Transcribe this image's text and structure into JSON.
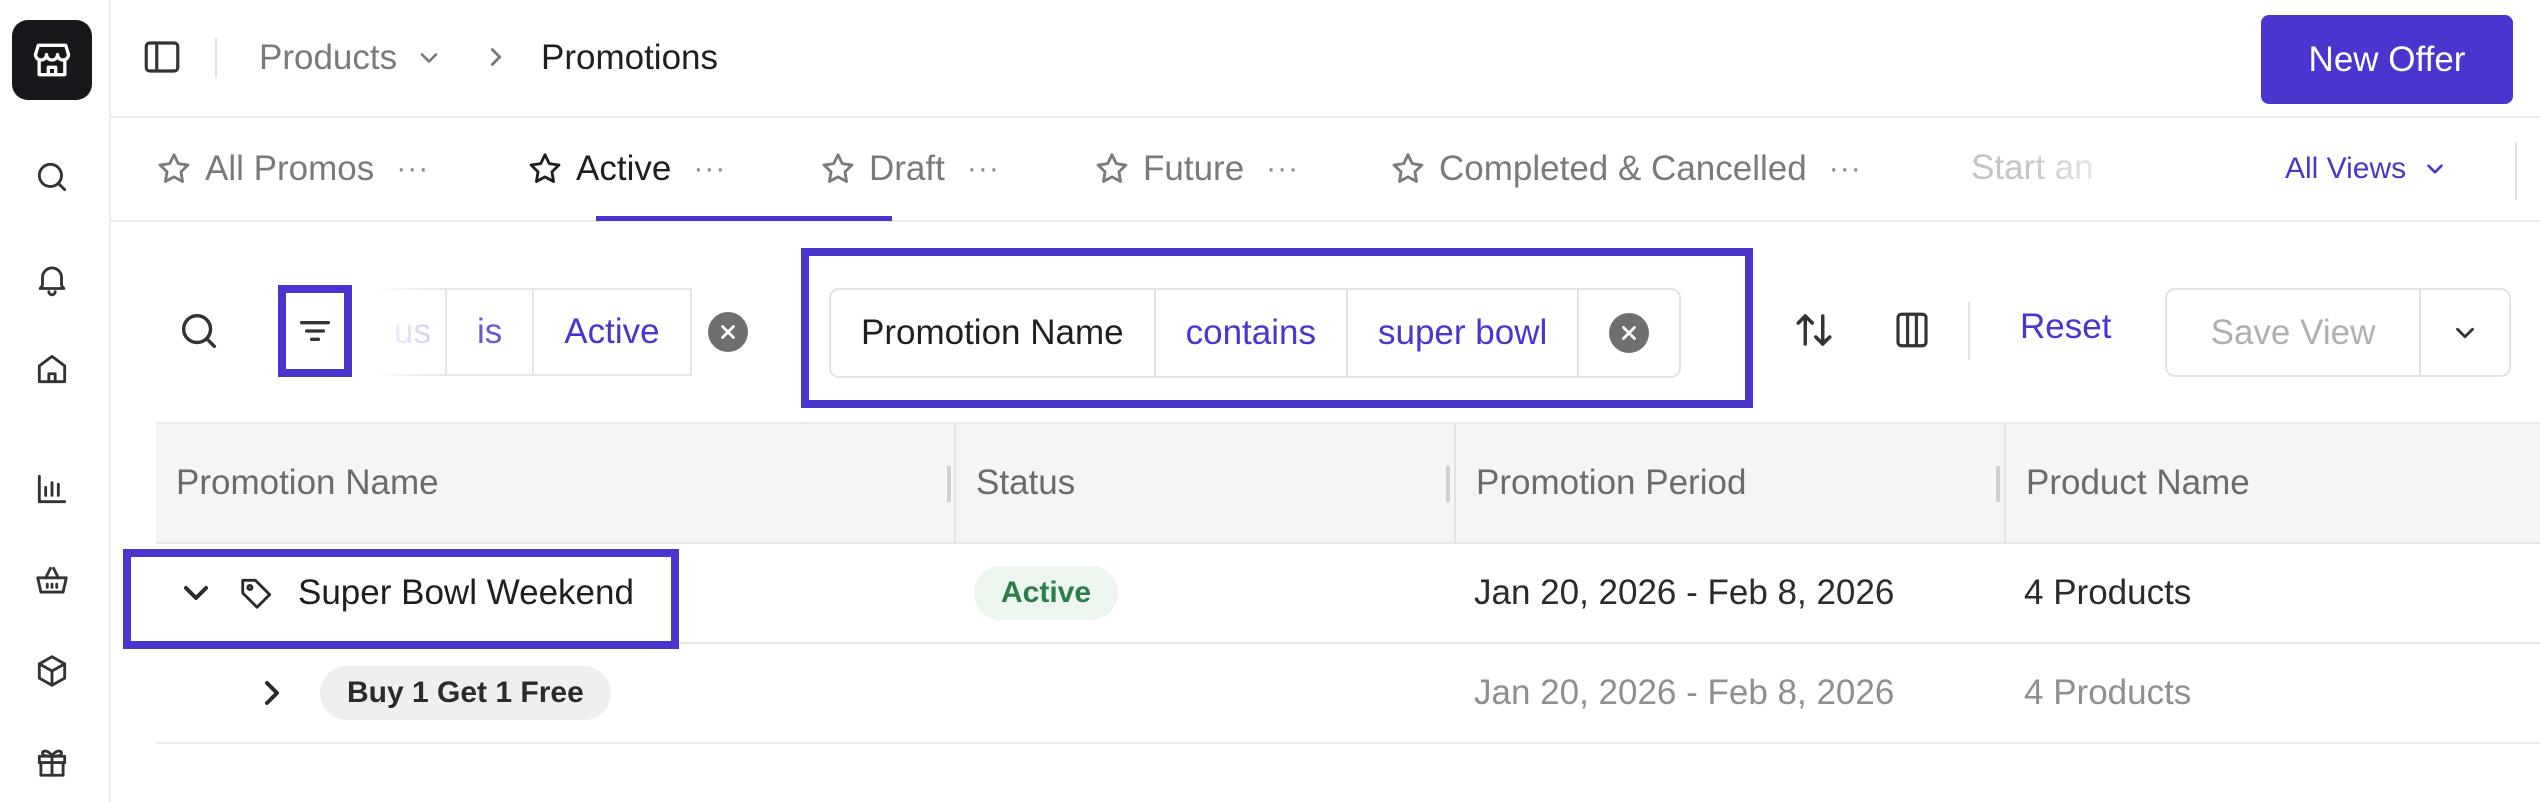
{
  "header": {
    "breadcrumb_parent": "Products",
    "breadcrumb_current": "Promotions",
    "new_offer_label": "New Offer"
  },
  "tabs": [
    {
      "label": "All Promos",
      "more": "···"
    },
    {
      "label": "Active",
      "more": "···"
    },
    {
      "label": "Draft",
      "more": "···"
    },
    {
      "label": "Future",
      "more": "···"
    },
    {
      "label": "Completed & Cancelled",
      "more": "···"
    }
  ],
  "tab_overflow_label": "Start an",
  "all_views_label": "All Views",
  "filter_bar": {
    "chip1_cut_fragment": "us",
    "chip1_operator": "is",
    "chip1_value": "Active",
    "chip2_field": "Promotion Name",
    "chip2_operator": "contains",
    "chip2_value": "super bowl",
    "reset_label": "Reset",
    "save_view_label": "Save View"
  },
  "table": {
    "columns": [
      "Promotion Name",
      "Status",
      "Promotion Period",
      "Product Name"
    ],
    "rows": [
      {
        "name": "Super Bowl Weekend",
        "status": "Active",
        "period": "Jan 20, 2026 - Feb 8, 2026",
        "products": "4 Products"
      },
      {
        "name": "Buy 1 Get 1 Free",
        "status": "",
        "period": "Jan 20, 2026 - Feb 8, 2026",
        "products": "4 Products"
      }
    ]
  },
  "colors": {
    "accent": "#4a35cf",
    "status_active_bg": "#ecf6ef",
    "status_active_fg": "#2c7d48"
  },
  "icons": [
    "store-icon",
    "search-icon",
    "bell-icon",
    "home-icon",
    "bar-chart-icon",
    "basket-icon",
    "box-icon",
    "gift-icon",
    "sidebar-toggle-icon",
    "star-icon",
    "filter-icon",
    "sort-icon",
    "columns-icon",
    "clear-icon",
    "chevron-down-icon",
    "chevron-right-icon",
    "plus-icon",
    "tag-icon"
  ]
}
